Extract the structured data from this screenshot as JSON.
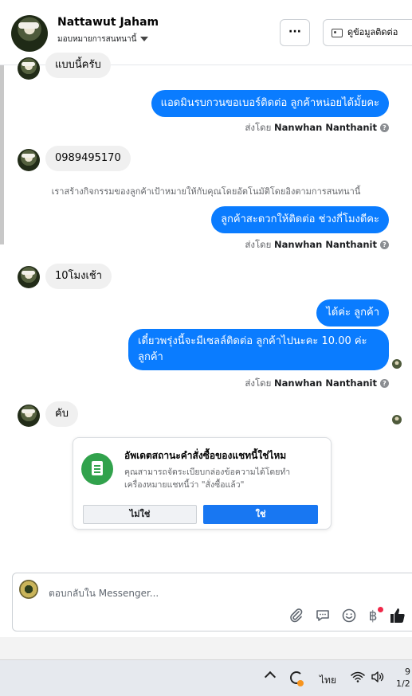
{
  "header": {
    "contact_name": "Nattawut Jaham",
    "assign_label": "มอบหมายการสนทนานี้",
    "more_label": "···",
    "contact_info_label": "ดูข้อมูลติดต่อ"
  },
  "messages": {
    "partial_top": "แบบนี้ครับ",
    "out1": "แอดมินรบกวนขอเบอร์ติดต่อ ลูกค้าหน่อยได้มั้ยคะ",
    "in_phone": "0989495170",
    "system_note": "เราสร้างกิจกรรมของลูกค้าเป้าหมายให้กับคุณโดยอัตโนมัติโดยอิงตามการสนทนานี้",
    "out2": "ลูกค้าสะดวกให้ติดต่อ ช่วงกี่โมงดีคะ",
    "in_time": "10โมงเช้า",
    "out3": "ได้ค่ะ ลูกค้า",
    "out4": "เดี๋ยวพรุ่งนี้จะมีเซลล์ติดต่อ ลูกค้าไปนะคะ 10.00 ค่ะ ลูกค้า",
    "in_ok": "คับ",
    "sent_by_prefix": "ส่งโดย",
    "sent_by_name": "Nanwhan Nanthanit",
    "help_mark": "?"
  },
  "order_card": {
    "title": "อัพเดตสถานะคำสั่งซื้อของแชทนี้ใช่ไหม",
    "description": "คุณสามารถจัดระเบียบกล่องข้อความได้โดยทำเครื่องหมายแชทนี้ว่า \"สั่งซื้อแล้ว\"",
    "no_label": "ไม่ใช่",
    "yes_label": "ใช่"
  },
  "composer": {
    "placeholder": "ตอบกลับใน Messenger..."
  },
  "icons": {
    "attach": "paperclip-icon",
    "chat": "saved-reply-icon",
    "emoji": "emoji-icon",
    "baht": "฿",
    "thumb": "👍"
  },
  "taskbar": {
    "language": "ไทย",
    "time": "9",
    "date": "1/2"
  },
  "colors": {
    "outgoing_bubble": "#0a7cff",
    "incoming_bubble": "#f0f0f0",
    "yes_button": "#1877f2",
    "card_icon": "#31a24c"
  }
}
